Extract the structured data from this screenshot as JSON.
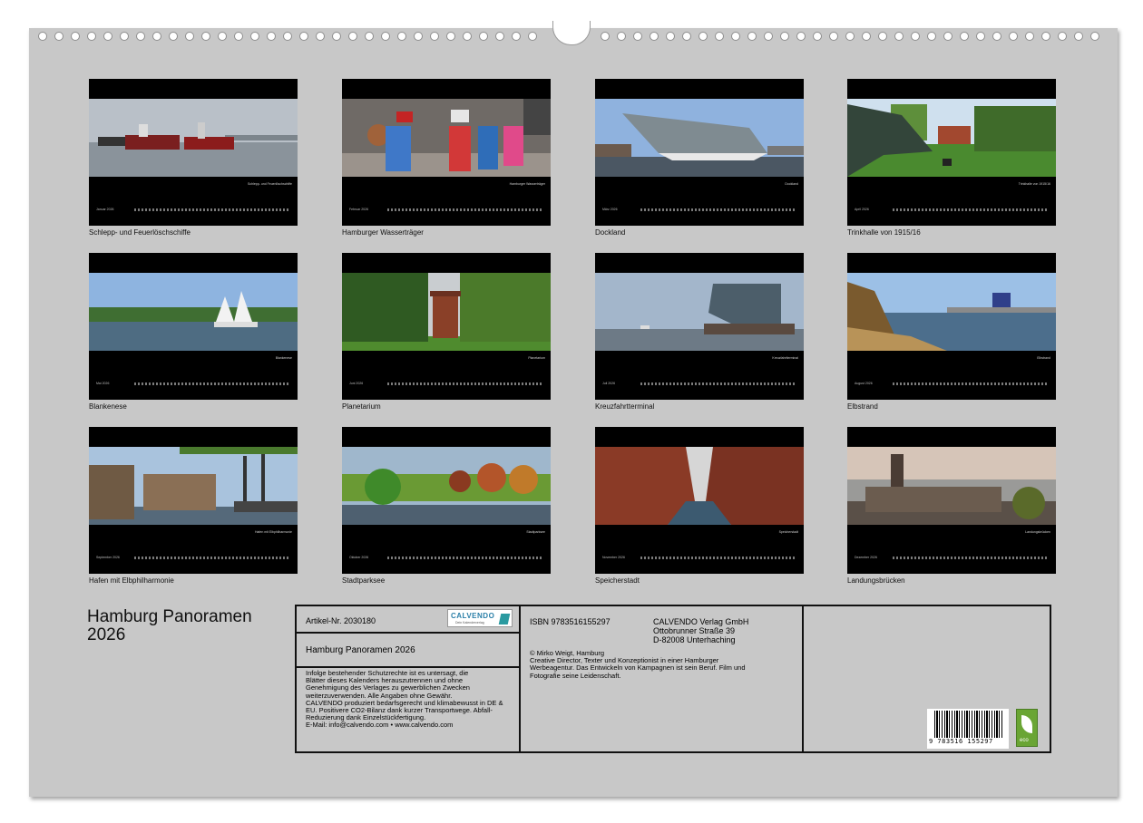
{
  "months": [
    {
      "caption": "Schlepp- und Feuerlöschschiffe",
      "label": "Schlepp- und Feuerlöschschiffe",
      "month_label": "Januar 2026"
    },
    {
      "caption": "Hamburger Wasserträger",
      "label": "Hamburger Wasserträger",
      "month_label": "Februar 2026"
    },
    {
      "caption": "Dockland",
      "label": "Dockland",
      "month_label": "März 2026"
    },
    {
      "caption": "Trinkhalle von 1915/16",
      "label": "Trinkhalle von 1915/16",
      "month_label": "April 2026"
    },
    {
      "caption": "Blankenese",
      "label": "Blankenese",
      "month_label": "Mai 2026"
    },
    {
      "caption": "Planetarium",
      "label": "Planetarium",
      "month_label": "Juni 2026"
    },
    {
      "caption": "Kreuzfahrtterminal",
      "label": "Kreuzfahrtterminal",
      "month_label": "Juli 2026"
    },
    {
      "caption": "Elbstrand",
      "label": "Elbstrand",
      "month_label": "August 2026"
    },
    {
      "caption": "Hafen mit Elbphilharmonie",
      "label": "Hafen mit Elbphilharmonie",
      "month_label": "September 2026"
    },
    {
      "caption": "Stadtparksee",
      "label": "Stadtparksee",
      "month_label": "Oktober 2026"
    },
    {
      "caption": "Speicherstadt",
      "label": "Speicherstadt",
      "month_label": "November 2026"
    },
    {
      "caption": "Landungsbrücken",
      "label": "Landungsbrücken",
      "month_label": "Dezember 2026"
    }
  ],
  "cover": {
    "title_line1": "Hamburg Panoramen",
    "title_line2": "2026"
  },
  "info": {
    "article": "Artikel-Nr. 2030180",
    "logo_brand": "CALVENDO",
    "logo_tag": "Dein Kalenderverlag",
    "calendar_title": "Hamburg Panoramen 2026",
    "legal_lines": [
      "Infolge bestehender Schutzrechte ist es untersagt, die",
      "Blätter dieses Kalenders herauszutrennen und ohne",
      "Genehmigung des Verlages zu gewerblichen Zwecken",
      "weiterzuverwenden. Alle Angaben ohne Gewähr.",
      "CALVENDO produziert bedarfsgerecht und klimabewusst in DE &",
      "EU. Positivere CO2-Bilanz dank kurzer Transportwege. Abfall-",
      "Reduzierung dank Einzelstückfertigung.",
      "E-Mail: info@calvendo.com • www.calvendo.com"
    ],
    "isbn": "ISBN 9783516155297",
    "publisher_lines": [
      "CALVENDO Verlag GmbH",
      "Ottobrunner Straße 39",
      "D-82008 Unterhaching"
    ],
    "author_lines": [
      "© Mirko Weigt, Hamburg",
      "Creative Director, Texter und Konzeptionist in einer Hamburger",
      "Werbeagentur. Das Entwickeln von Kampagnen ist sein Beruf. Film und",
      "Fotografie seine Leidenschaft."
    ],
    "barcode_digits": "9 783516 155297",
    "eco_label": "eco"
  }
}
